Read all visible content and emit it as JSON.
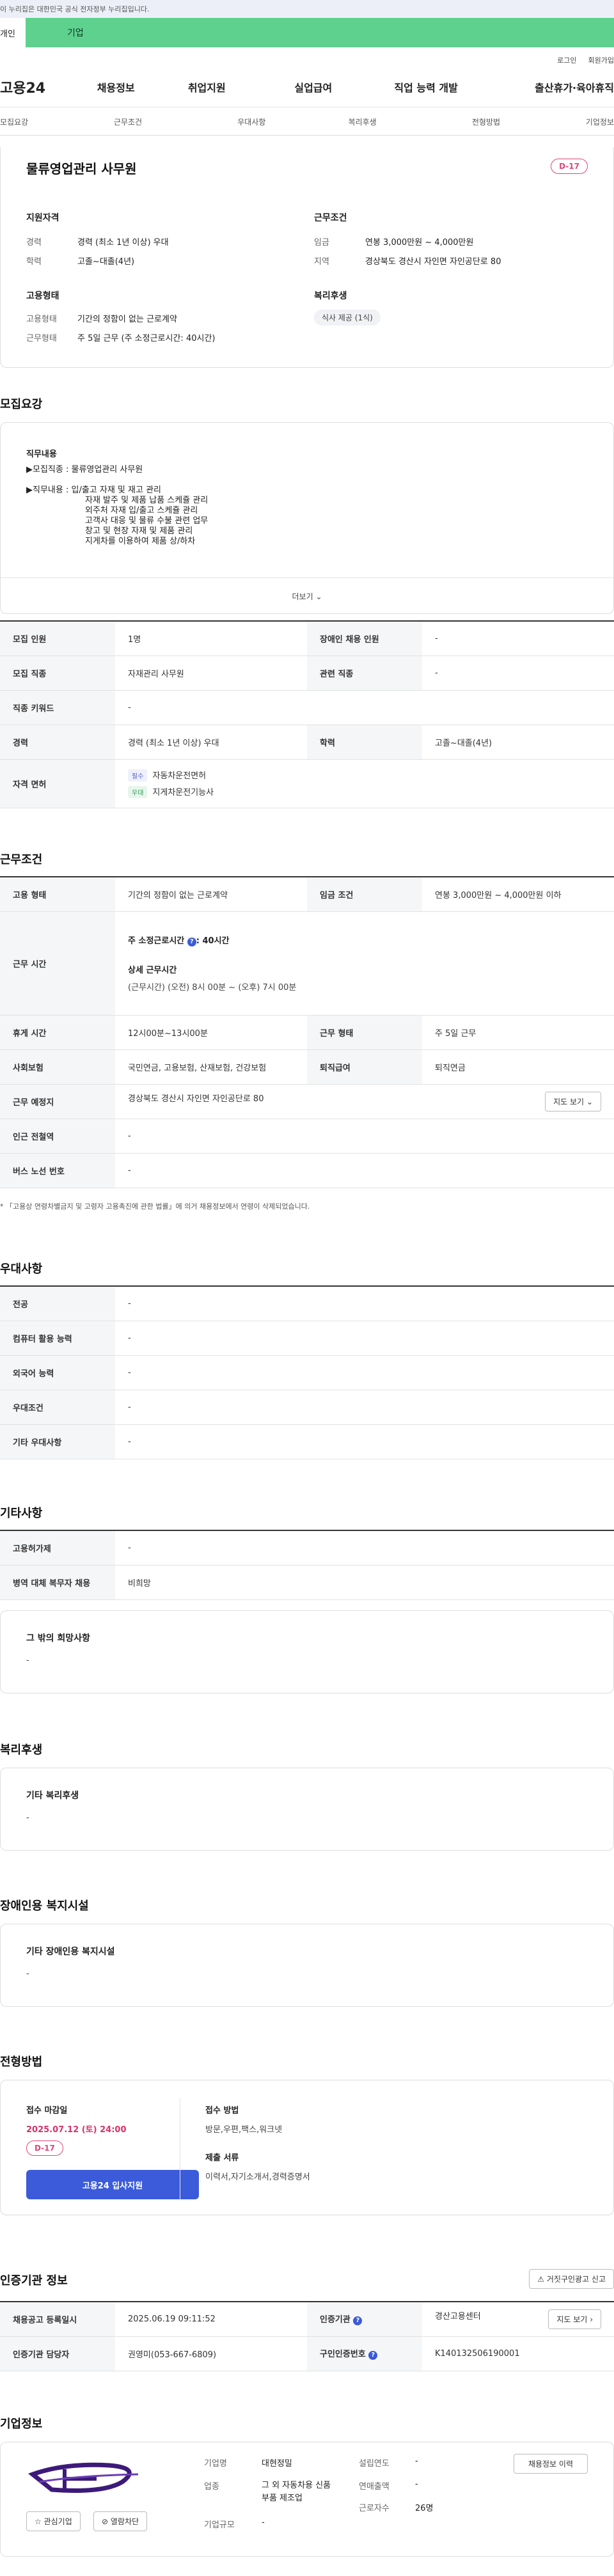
{
  "gov_banner": "이 누리집은 대한민국 공식 전자정부 누리집입니다.",
  "tabs": {
    "personal": "개인",
    "company": "기업"
  },
  "util": {
    "login": "로그인",
    "join": "회원가입"
  },
  "gnb": {
    "logo": "고용24",
    "items": [
      "채용정보",
      "취업지원",
      "실업급여",
      "직업 능력 개발",
      "출산휴가·육아휴직"
    ]
  },
  "subnav": [
    "모집요강",
    "근무조건",
    "우대사항",
    "복리후생",
    "전형방법",
    "기업정보"
  ],
  "summary": {
    "title": "물류영업관리 사무원",
    "dday": "D-17",
    "qual_title": "지원자격",
    "career_label": "경력",
    "career": "경력 (최소 1년 이상) 우대",
    "edu_label": "학력",
    "edu": "고졸~대졸(4년)",
    "cond_title": "근무조건",
    "wage_label": "임금",
    "wage": "연봉 3,000만원 ~ 4,000만원",
    "region_label": "지역",
    "region": "경상북도 경산시 자인면 자인공단로 80",
    "emp_title": "고용형태",
    "emptype_label": "고용형태",
    "emptype": "기간의 정함이 없는 근로계약",
    "worktype_label": "근무형태",
    "worktype": "주 5일 근무 (주 소정근로시간: 40시간)",
    "welfare_title": "복리후생",
    "welfare_tag": "식사 제공 (1식)"
  },
  "recruit": {
    "title": "모집요강",
    "duty_title": "직무내용",
    "lines": [
      "▶모집직종 : 물류영업관리 사무원",
      "",
      "▶직무내용 : 입/출고 자재 및 재고 관리",
      "자재 발주 및 제품 납품 스케쥴 관리",
      "외주처 자재 입/출고 스케쥴 관리",
      "고객사 대응 및 물류 수불 관련 업무",
      "창고 및 현장 자재 및 제품 관리",
      "지게차를 이용하여 제품 상/하차"
    ],
    "more": "더보기",
    "rows": [
      {
        "k1": "모집 인원",
        "v1": "1명",
        "k2": "장애인 채용 인원",
        "v2": "-"
      },
      {
        "k1": "모집 직종",
        "v1": "자재관리 사무원",
        "k2": "관련 직종",
        "v2": "-"
      },
      {
        "k1": "직종 키워드",
        "v1": "-"
      },
      {
        "k1": "경력",
        "v1": "경력 (최소 1년 이상) 우대",
        "k2": "학력",
        "v2": "고졸~대졸(4년)"
      }
    ],
    "license_label": "자격 면허",
    "licenses": [
      {
        "tag": "필수",
        "name": "자동차운전면허"
      },
      {
        "tag": "우대",
        "name": "지게차운전기능사"
      }
    ]
  },
  "work": {
    "title": "근무조건",
    "emptype_label": "고용 형태",
    "emptype": "기간의 정함이 없는 근로계약",
    "wage_label": "임금 조건",
    "wage": "연봉 3,000만원 ~ 4,000만원 이하",
    "hours_label": "근무 시간",
    "week_hours_prefix": "주 소정근로시간",
    "week_hours": ": 40시간",
    "detail_title": "상세 근무시간",
    "detail": "(근무시간) (오전) 8시 00분 ~ (오후) 7시 00분",
    "break_label": "휴게 시간",
    "break": "12시00분~13시00분",
    "shift_label": "근무 형태",
    "shift": "주 5일 근무",
    "insurance_label": "사회보험",
    "insurance": "국민연금, 고용보험, 산재보험, 건강보험",
    "retire_label": "퇴직급여",
    "retire": "퇴직연금",
    "place_label": "근무 예정지",
    "place": "경상북도 경산시 자인면 자인공단로 80",
    "map_btn": "지도 보기",
    "subway_label": "인근 전철역",
    "subway": "-",
    "bus_label": "버스 노선 번호",
    "bus": "-",
    "note": "* 「고용상 연령차별금지 및 고령자 고용촉진에 관한 법률」에 의거 채용정보에서 연령이 삭제되었습니다."
  },
  "pref": {
    "title": "우대사항",
    "rows": [
      {
        "k": "전공",
        "v": "-"
      },
      {
        "k": "컴퓨터 활용 능력",
        "v": "-"
      },
      {
        "k": "외국어 능력",
        "v": "-"
      },
      {
        "k": "우대조건",
        "v": "-"
      },
      {
        "k": "기타 우대사항",
        "v": "-"
      }
    ]
  },
  "etc": {
    "title": "기타사항",
    "rows": [
      {
        "k": "고용허가제",
        "v": "-"
      },
      {
        "k": "병역 대체 복무자 채용",
        "v": "비희망"
      }
    ],
    "box_title": "그 밖의 희망사항",
    "box_value": "-"
  },
  "welfare": {
    "title": "복리후생",
    "box_title": "기타 복리후생",
    "box_value": "-"
  },
  "disabled": {
    "title": "장애인용 복지시설",
    "box_title": "기타 장애인용 복지시설",
    "box_value": "-"
  },
  "screening": {
    "title": "전형방법",
    "deadline_label": "접수 마감일",
    "deadline": "2025.07.12 (토) 24:00",
    "dday": "D-17",
    "apply_btn": "고용24 입사지원",
    "method_label": "접수 방법",
    "method": "방문,우편,팩스,워크넷",
    "docs_label": "제출 서류",
    "docs": "이력서,자기소개서,경력증명서"
  },
  "cert": {
    "title": "인증기관 정보",
    "report_btn": "거짓구인광고 신고",
    "reg_label": "채용공고 등록일시",
    "reg": "2025.06.19 09:11:52",
    "org_label": "인증기관",
    "org": "경산고용센터",
    "map_btn": "지도 보기",
    "mgr_label": "인증기관 담당자",
    "mgr": "권영미(053-667-6809)",
    "job_no_label": "구인인증번호",
    "job_no": "K140132506190001"
  },
  "company": {
    "title": "기업정보",
    "logo_text": "대현정밀",
    "fav_btn": "관심기업",
    "block_btn": "열람차단",
    "name_label": "기업명",
    "name": "대현정밀",
    "industry_label": "업종",
    "industry": "그 외 자동차용 신품 부품 제조업",
    "size_label": "기업규모",
    "size": "-",
    "founded_label": "설립연도",
    "founded": "-",
    "revenue_label": "연매출액",
    "revenue": "-",
    "staff_label": "근로자수",
    "staff": "26명",
    "jobs_btn": "채용정보 이력"
  }
}
